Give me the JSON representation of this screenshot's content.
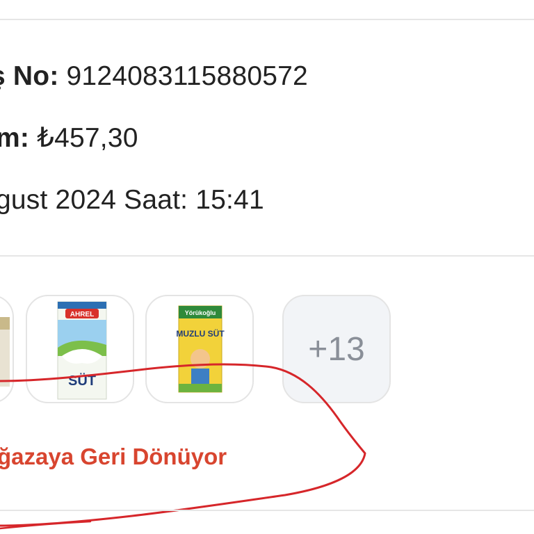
{
  "order": {
    "order_no_label": "ş No:",
    "order_no_value": "9124083115880572",
    "total_label": "m:",
    "total_value": "₺457,30",
    "date_text": "gust 2024 Saat: 15:41"
  },
  "products": [
    {
      "name": "partial product",
      "brand_text": ""
    },
    {
      "name": "Ahrel süt",
      "brand_text": "AHREL",
      "label_text": "SÜT"
    },
    {
      "name": "Yörükoğlu muzlu süt",
      "brand_text": "Yörükoğlu",
      "label_text": "MUZLU SÜT"
    }
  ],
  "more_count": "+13",
  "status": {
    "text": "ğazaya Geri Dönüyor",
    "color": "#d8452f"
  },
  "annotation": {
    "color": "#d6262a"
  }
}
